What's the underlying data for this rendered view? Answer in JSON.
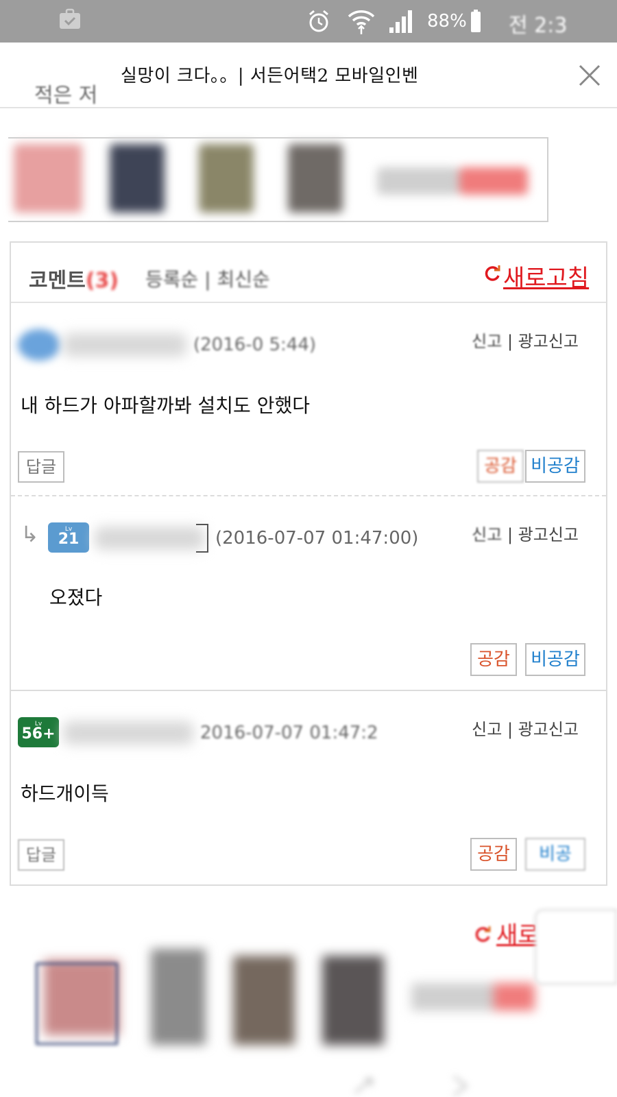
{
  "status_bar": {
    "battery": "88%",
    "time": "전 2:3"
  },
  "background_page": {
    "text": "적은 저"
  },
  "popup": {
    "title": "실망이 크다。。| 서든어택2 모바일인벤"
  },
  "comments_section": {
    "title": "코멘트",
    "count": "(3)",
    "sort_options": "등록순 | 최신순",
    "refresh_label": "새로고침",
    "items": [
      {
        "date": "(2016-0        5:44)",
        "report": "신고",
        "ad_report": "광고신고",
        "text": "내 하드가 아파할까봐 설치도 안했다",
        "reply_label": "답글",
        "like_label": "공감",
        "unlike_label": "비공감"
      },
      {
        "level": "21",
        "level_prefix": "Lv",
        "date": "(2016-07-07 01:47:00)",
        "report": "신고",
        "ad_report": "광고신고",
        "text": "오졌다",
        "like_label": "공감",
        "unlike_label": "비공감"
      },
      {
        "level": "56+",
        "level_prefix": "Lv",
        "date": "2016-07-07 01:47:2",
        "report": "신고",
        "ad_report": "광고신고",
        "text": "하드개이득",
        "reply_label": "답글",
        "like_label": "공감",
        "unlike_label": "비공"
      }
    ]
  },
  "bottom": {
    "refresh_label": "새로"
  },
  "colors": {
    "accent_red": "#e0191f",
    "like_orange": "#d9532b",
    "unlike_blue": "#1f7fcc",
    "level_blue": "#5b9bd0",
    "level_green": "#1e7a3a"
  }
}
